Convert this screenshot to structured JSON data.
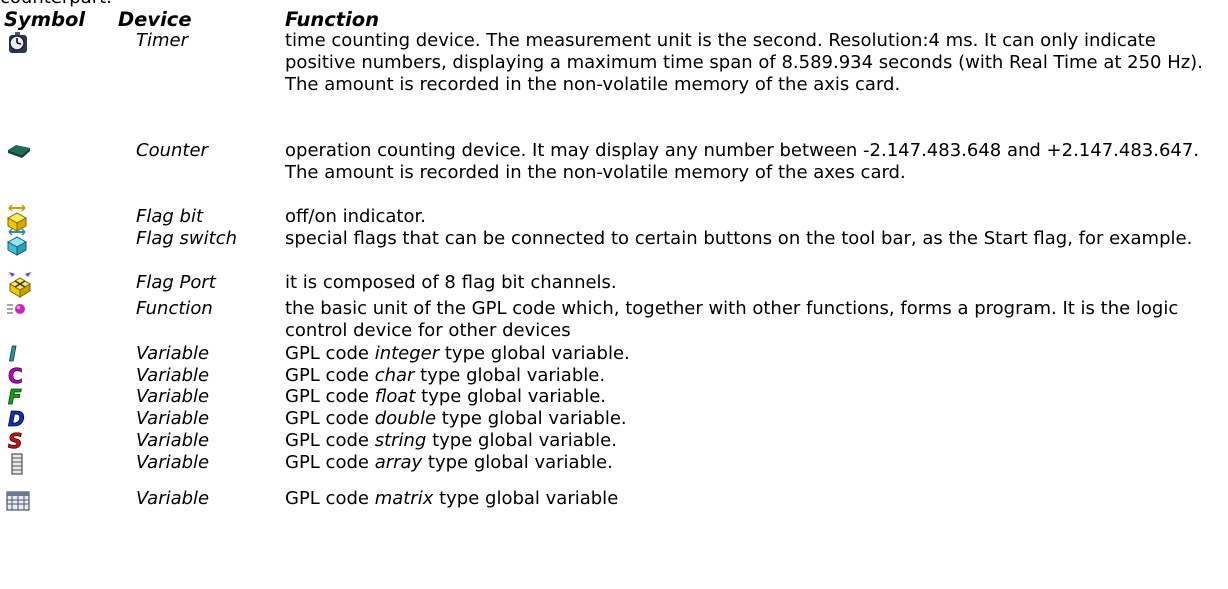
{
  "top_cut_text": "counterpart.",
  "headers": {
    "symbol": "Symbol",
    "device": "Device",
    "function": "Function"
  },
  "rows": [
    {
      "icon": "timer-icon",
      "device": "Timer",
      "function": "time counting device. The measurement unit is the second. Resolution:4 ms. It can only indicate positive numbers, displaying a maximum time span of 8.589.934 seconds (with Real Time at 250 Hz). The amount is recorded in the non-volatile memory of the axis card."
    },
    {
      "icon": "counter-chip-icon",
      "device": "Counter",
      "function": "operation counting device. It may display any number between -2.147.483.648 and +2.147.483.647. The amount is recorded in the non-volatile memory of the axes card."
    },
    {
      "icon": "flag-bit-icon",
      "device": "Flag bit",
      "function": "off/on indicator."
    },
    {
      "icon": "flag-switch-icon",
      "device": "Flag switch",
      "function": "special flags that can be connected to certain buttons on the tool bar, as the Start flag, for example."
    },
    {
      "icon": "flag-port-icon",
      "device": "Flag Port",
      "function": "it is composed of 8 flag bit channels."
    },
    {
      "icon": "function-icon",
      "device": "Function",
      "function": "the basic unit of the GPL code which, together with other functions, forms a program. It is the logic control device for other devices"
    },
    {
      "icon": "integer-variable-icon",
      "device": "Variable",
      "prefix": "GPL code ",
      "type": "integer",
      "suffix": " type global variable."
    },
    {
      "icon": "char-variable-icon",
      "device": "Variable",
      "prefix": "GPL code ",
      "type": "char",
      "suffix": " type global variable."
    },
    {
      "icon": "float-variable-icon",
      "device": "Variable",
      "prefix": "GPL code ",
      "type": "float",
      "suffix": " type global variable."
    },
    {
      "icon": "double-variable-icon",
      "device": "Variable",
      "prefix": "GPL code ",
      "type": "double",
      "suffix": " type global variable."
    },
    {
      "icon": "string-variable-icon",
      "device": "Variable",
      "prefix": "GPL code ",
      "type": "string",
      "suffix": " type global variable."
    },
    {
      "icon": "array-variable-icon",
      "device": "Variable",
      "prefix": "GPL code ",
      "type": "array",
      "suffix": " type global variable."
    },
    {
      "icon": "matrix-variable-icon",
      "device": "Variable",
      "prefix": "GPL code ",
      "type": "matrix",
      "suffix": " type global variable"
    }
  ],
  "icon_letters": {
    "integer": "I",
    "char": "C",
    "float": "F",
    "double": "D",
    "string": "S"
  },
  "colors": {
    "integer": "#1a9a9a",
    "char": "#c000c0",
    "float": "#16a016",
    "double": "#1030c0",
    "string": "#d01010"
  }
}
